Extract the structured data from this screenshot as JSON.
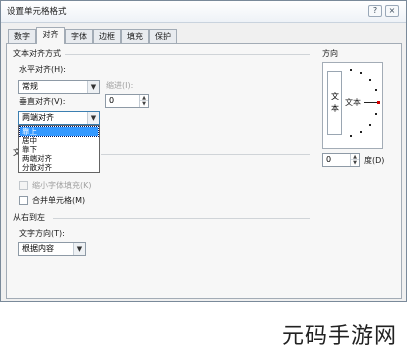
{
  "dialog": {
    "title": "设置单元格格式",
    "help_label": "?",
    "close_label": "×"
  },
  "tabs": [
    "数字",
    "对齐",
    "字体",
    "边框",
    "填充",
    "保护"
  ],
  "active_tab": "对齐",
  "alignment": {
    "section_title": "文本对齐方式",
    "horizontal_label": "水平对齐(H):",
    "horizontal_value": "常规",
    "indent_label": "缩进(I):",
    "indent_value": "0",
    "vertical_label": "垂直对齐(V):",
    "vertical_value": "两端对齐",
    "vertical_options": [
      "靠上",
      "居中",
      "靠下",
      "两端对齐",
      "分散对齐"
    ],
    "vertical_selected": "靠上"
  },
  "text_control": {
    "section_title_partial": "文",
    "shrink_label": "缩小字体填充(K)",
    "merge_label": "合并单元格(M)"
  },
  "rtl": {
    "section_title": "从右到左",
    "direction_label": "文字方向(T):",
    "direction_value": "根据内容"
  },
  "orientation": {
    "section_title": "方向",
    "vertical_text": [
      "文",
      "本"
    ],
    "arc_text": "文本",
    "degrees_value": "0",
    "degrees_label": "度(D)"
  },
  "watermark": "元码手游网"
}
